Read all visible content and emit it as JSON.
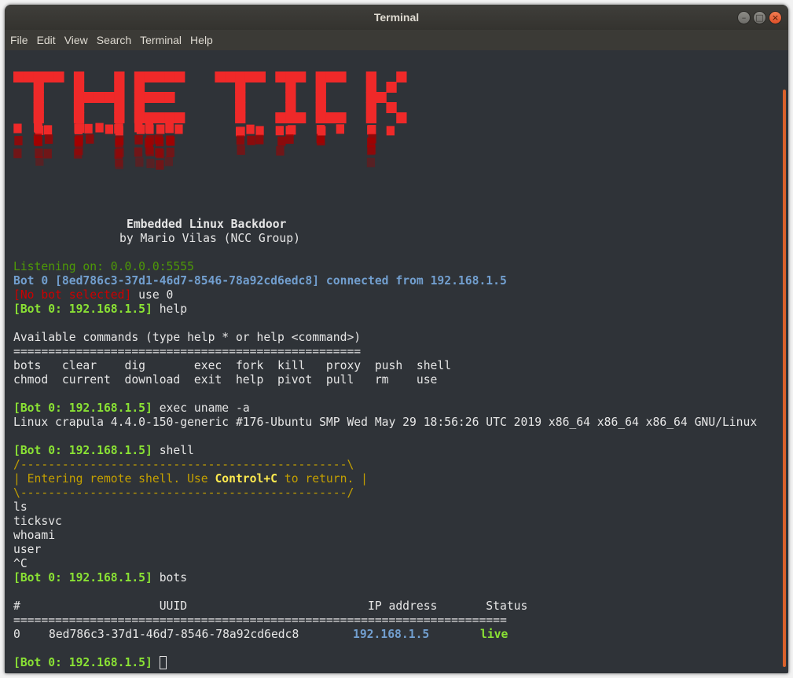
{
  "window": {
    "title": "Terminal"
  },
  "menu": [
    "File",
    "Edit",
    "View",
    "Search",
    "Terminal",
    "Help"
  ],
  "banner": {
    "logo_text": "THE TICK",
    "subtitle": "Embedded Linux Backdoor",
    "author": "by Mario Vilas (NCC Group)"
  },
  "session": {
    "listening": "Listening on: 0.0.0.0:5555",
    "bot_connect": {
      "prefix": "Bot 0 [8ed786c3-37d1-46d7-8546-78a92cd6edc8]",
      "mid": "connected from",
      "ip": "192.168.1.5"
    },
    "no_bot_prompt": "[No bot selected]",
    "prompt": "[Bot 0: 192.168.1.5]",
    "cmd_use": " use 0",
    "cmd_help": " help",
    "available": "Available commands (type help * or help <command>)",
    "sep_help": "==================================================",
    "commands_row1": "bots   clear    dig       exec  fork  kill   proxy  push  shell",
    "commands_row2": "chmod  current  download  exit  help  pivot  pull   rm    use",
    "cmd_exec": " exec uname -a",
    "uname_output": "Linux crapula 4.4.0-150-generic #176-Ubuntu SMP Wed May 29 18:56:26 UTC 2019 x86_64 x86_64 x86_64 GNU/Linux",
    "cmd_shell": " shell",
    "box_top": "/-----------------------------------------------\\",
    "box_mid_a": "| Entering remote shell. Use ",
    "box_mid_key": "Control+C",
    "box_mid_b": " to return. |",
    "box_bot": "\\-----------------------------------------------/",
    "shell_lines": [
      "ls",
      "ticksvc",
      "whoami",
      "user",
      "^C"
    ],
    "cmd_bots": " bots",
    "table_header": "#                    UUID                          IP address       Status",
    "sep_table": "=======================================================================",
    "row": {
      "index": "0",
      "uuid": "8ed786c3-37d1-46d7-8546-78a92cd6edc8",
      "ip": "192.168.1.5",
      "status": "live"
    }
  },
  "colors": {
    "logo_red": "#ef2929",
    "logo_dark": "#a40000",
    "accent_orange": "#d9612b"
  }
}
